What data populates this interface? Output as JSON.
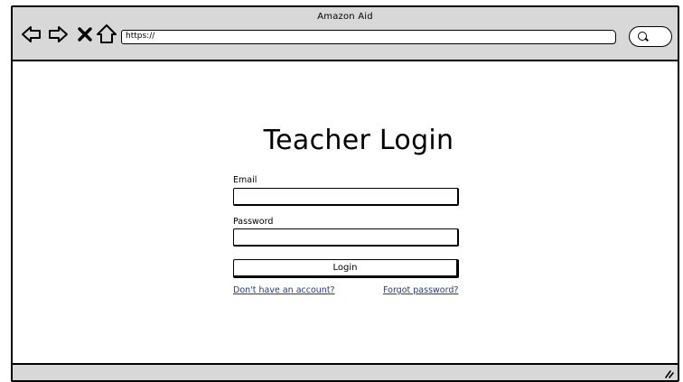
{
  "window": {
    "title": "Amazon Aid"
  },
  "toolbar": {
    "back_icon": "back-arrow-icon",
    "forward_icon": "forward-arrow-icon",
    "close_icon": "close-icon",
    "home_icon": "home-icon",
    "url": "https://",
    "search_icon": "search-icon"
  },
  "login": {
    "title": "Teacher Login",
    "email_label": "Email",
    "email_value": "",
    "password_label": "Password",
    "password_value": "",
    "login_button": "Login",
    "signup_link": "Don't have an account?",
    "forgot_link": "Forgot password?"
  },
  "colors": {
    "chrome": "#d8d8d8",
    "link": "#1f3a93",
    "border": "#000000"
  }
}
